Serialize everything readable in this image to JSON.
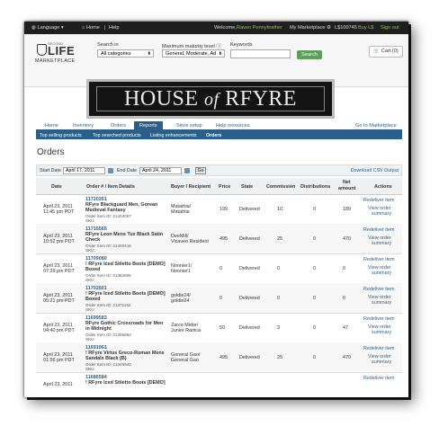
{
  "topbar": {
    "language": "Language",
    "home": "Home",
    "help": "Help",
    "welcome_prefix": "Welcome,",
    "user_name": "Raven Pennyfeather",
    "my_marketplace": "My Marketplace",
    "balance": "L$100745",
    "buy_ls": "Buy L$",
    "sign_out": "Sign out"
  },
  "logo": {
    "second": "SECOND",
    "life": "LIFE",
    "marketplace": "MARKETPLACE"
  },
  "search": {
    "search_in_label": "Search in",
    "search_in_value": "All categories",
    "maturity_label": "Maximum maturity level",
    "maturity_value": "General, Moderate, Ad",
    "keywords_label": "Keywords",
    "keywords_value": "",
    "search_button": "Search"
  },
  "cart": {
    "label": "Cart (0)"
  },
  "banner": {
    "left": "HOUSE",
    "of": "of",
    "right": "RFYRE"
  },
  "nav": {
    "home": "Home",
    "inventory": "Inventory",
    "orders": "Orders",
    "reports": "Reports",
    "store_setup": "Store setup",
    "help_resources": "Help resources",
    "go_to_marketplace": "Go to Marketplace"
  },
  "subnav": {
    "top_selling": "Top selling products",
    "top_searched": "Top searched products",
    "listing_enhancements": "Listing enhancements",
    "orders": "Orders"
  },
  "page_title": "Orders",
  "filter": {
    "start_label": "Start Date",
    "start_value": "April 17, 2011",
    "end_label": "End Date",
    "end_value": "April 24, 2011",
    "go": "Go",
    "download": "Download CSV Output"
  },
  "columns": {
    "date": "Date",
    "order": "Order # / Item Details",
    "buyer": "Buyer / Recipient",
    "price": "Price",
    "state": "State",
    "commission": "Commission",
    "distributions": "Distributions",
    "net_amount_1": "Net",
    "net_amount_2": "amount",
    "actions": "Actions"
  },
  "actions": {
    "redeliver": "Redeliver item",
    "view_summary_1": "View order",
    "view_summary_2": "summary"
  },
  "orders": [
    {
      "date1": "April 23, 2011",
      "date2": "11:45 pm PDT",
      "id": "11720261",
      "name": "RFyre Blackguard Men, Gorean Medieval Fantasy",
      "order_id": "Order Item ID: 21404097",
      "sku": "SKU:",
      "buyer1": "Matathia/",
      "buyer2": "Matathia",
      "price": "199",
      "state": "Delivered",
      "commission": "10",
      "distributions": "0",
      "net": "189"
    },
    {
      "date1": "April 23, 2011",
      "date2": "10:52 pm PDT",
      "id": "11715565",
      "name": "RFyre Leon Mens Tux Black Satin Check",
      "order_id": "Order Item ID: 21400416",
      "sku": "SKU:",
      "buyer1": "DeeMill/",
      "buyer2": "Vicaveo Resident",
      "price": "495",
      "state": "Delivered",
      "commission": "25",
      "distributions": "0",
      "net": "470"
    },
    {
      "date1": "April 23, 2011",
      "date2": "07:29 pm PDT",
      "id": "11709080",
      "name": "! RFyre Iced Stiletto Boots [DEMO] Boxed",
      "order_id": "Order Item ID: 21383605",
      "sku": "SKU:",
      "buyer1": "Noonier1/",
      "buyer2": "Noonier1",
      "price": "0",
      "state": "Delivered",
      "commission": "0",
      "distributions": "0",
      "net": "0"
    },
    {
      "date1": "April 23, 2011",
      "date2": "05:21 pm PDT",
      "id": "11702601",
      "name": "! RFyre Iced Stiletto Boots [DEMO] Boxed",
      "order_id": "Order Item ID: 21371162",
      "sku": "SKU:",
      "buyer1": "goldie24/",
      "buyer2": "goldie24",
      "price": "0",
      "state": "Delivered",
      "commission": "0",
      "distributions": "0",
      "net": "0"
    },
    {
      "date1": "April 23, 2011",
      "date2": "04:40 pm PDT",
      "id": "11699583",
      "name": "RFyre Gothic Crossroads for Men in Midnight",
      "order_id": "Order Item ID: 21366862",
      "sku": "SKU:",
      "buyer1": "Zarco Midor/",
      "buyer2": "Junior Ranica",
      "price": "50",
      "state": "Delivered",
      "commission": "3",
      "distributions": "0",
      "net": "47"
    },
    {
      "date1": "April 23, 2011",
      "date2": "01:56 pm PDT",
      "id": "11691061",
      "name": "! RFyre Virtus Greco-Roman Mens Sandals Black (B)",
      "order_id": "Order Item ID: 21349940",
      "sku": "SKU:",
      "buyer1": "General Gao/",
      "buyer2": "General Gao",
      "price": "495",
      "state": "Delivered",
      "commission": "25",
      "distributions": "0",
      "net": "470"
    },
    {
      "date1": "April 23, 2011",
      "date2": "",
      "id": "11686584",
      "name": "! RFyre Iced Stiletto Boots [DEMO]",
      "order_id": "",
      "sku": "",
      "buyer1": "",
      "buyer2": "",
      "price": "",
      "state": "",
      "commission": "",
      "distributions": "",
      "net": ""
    }
  ]
}
